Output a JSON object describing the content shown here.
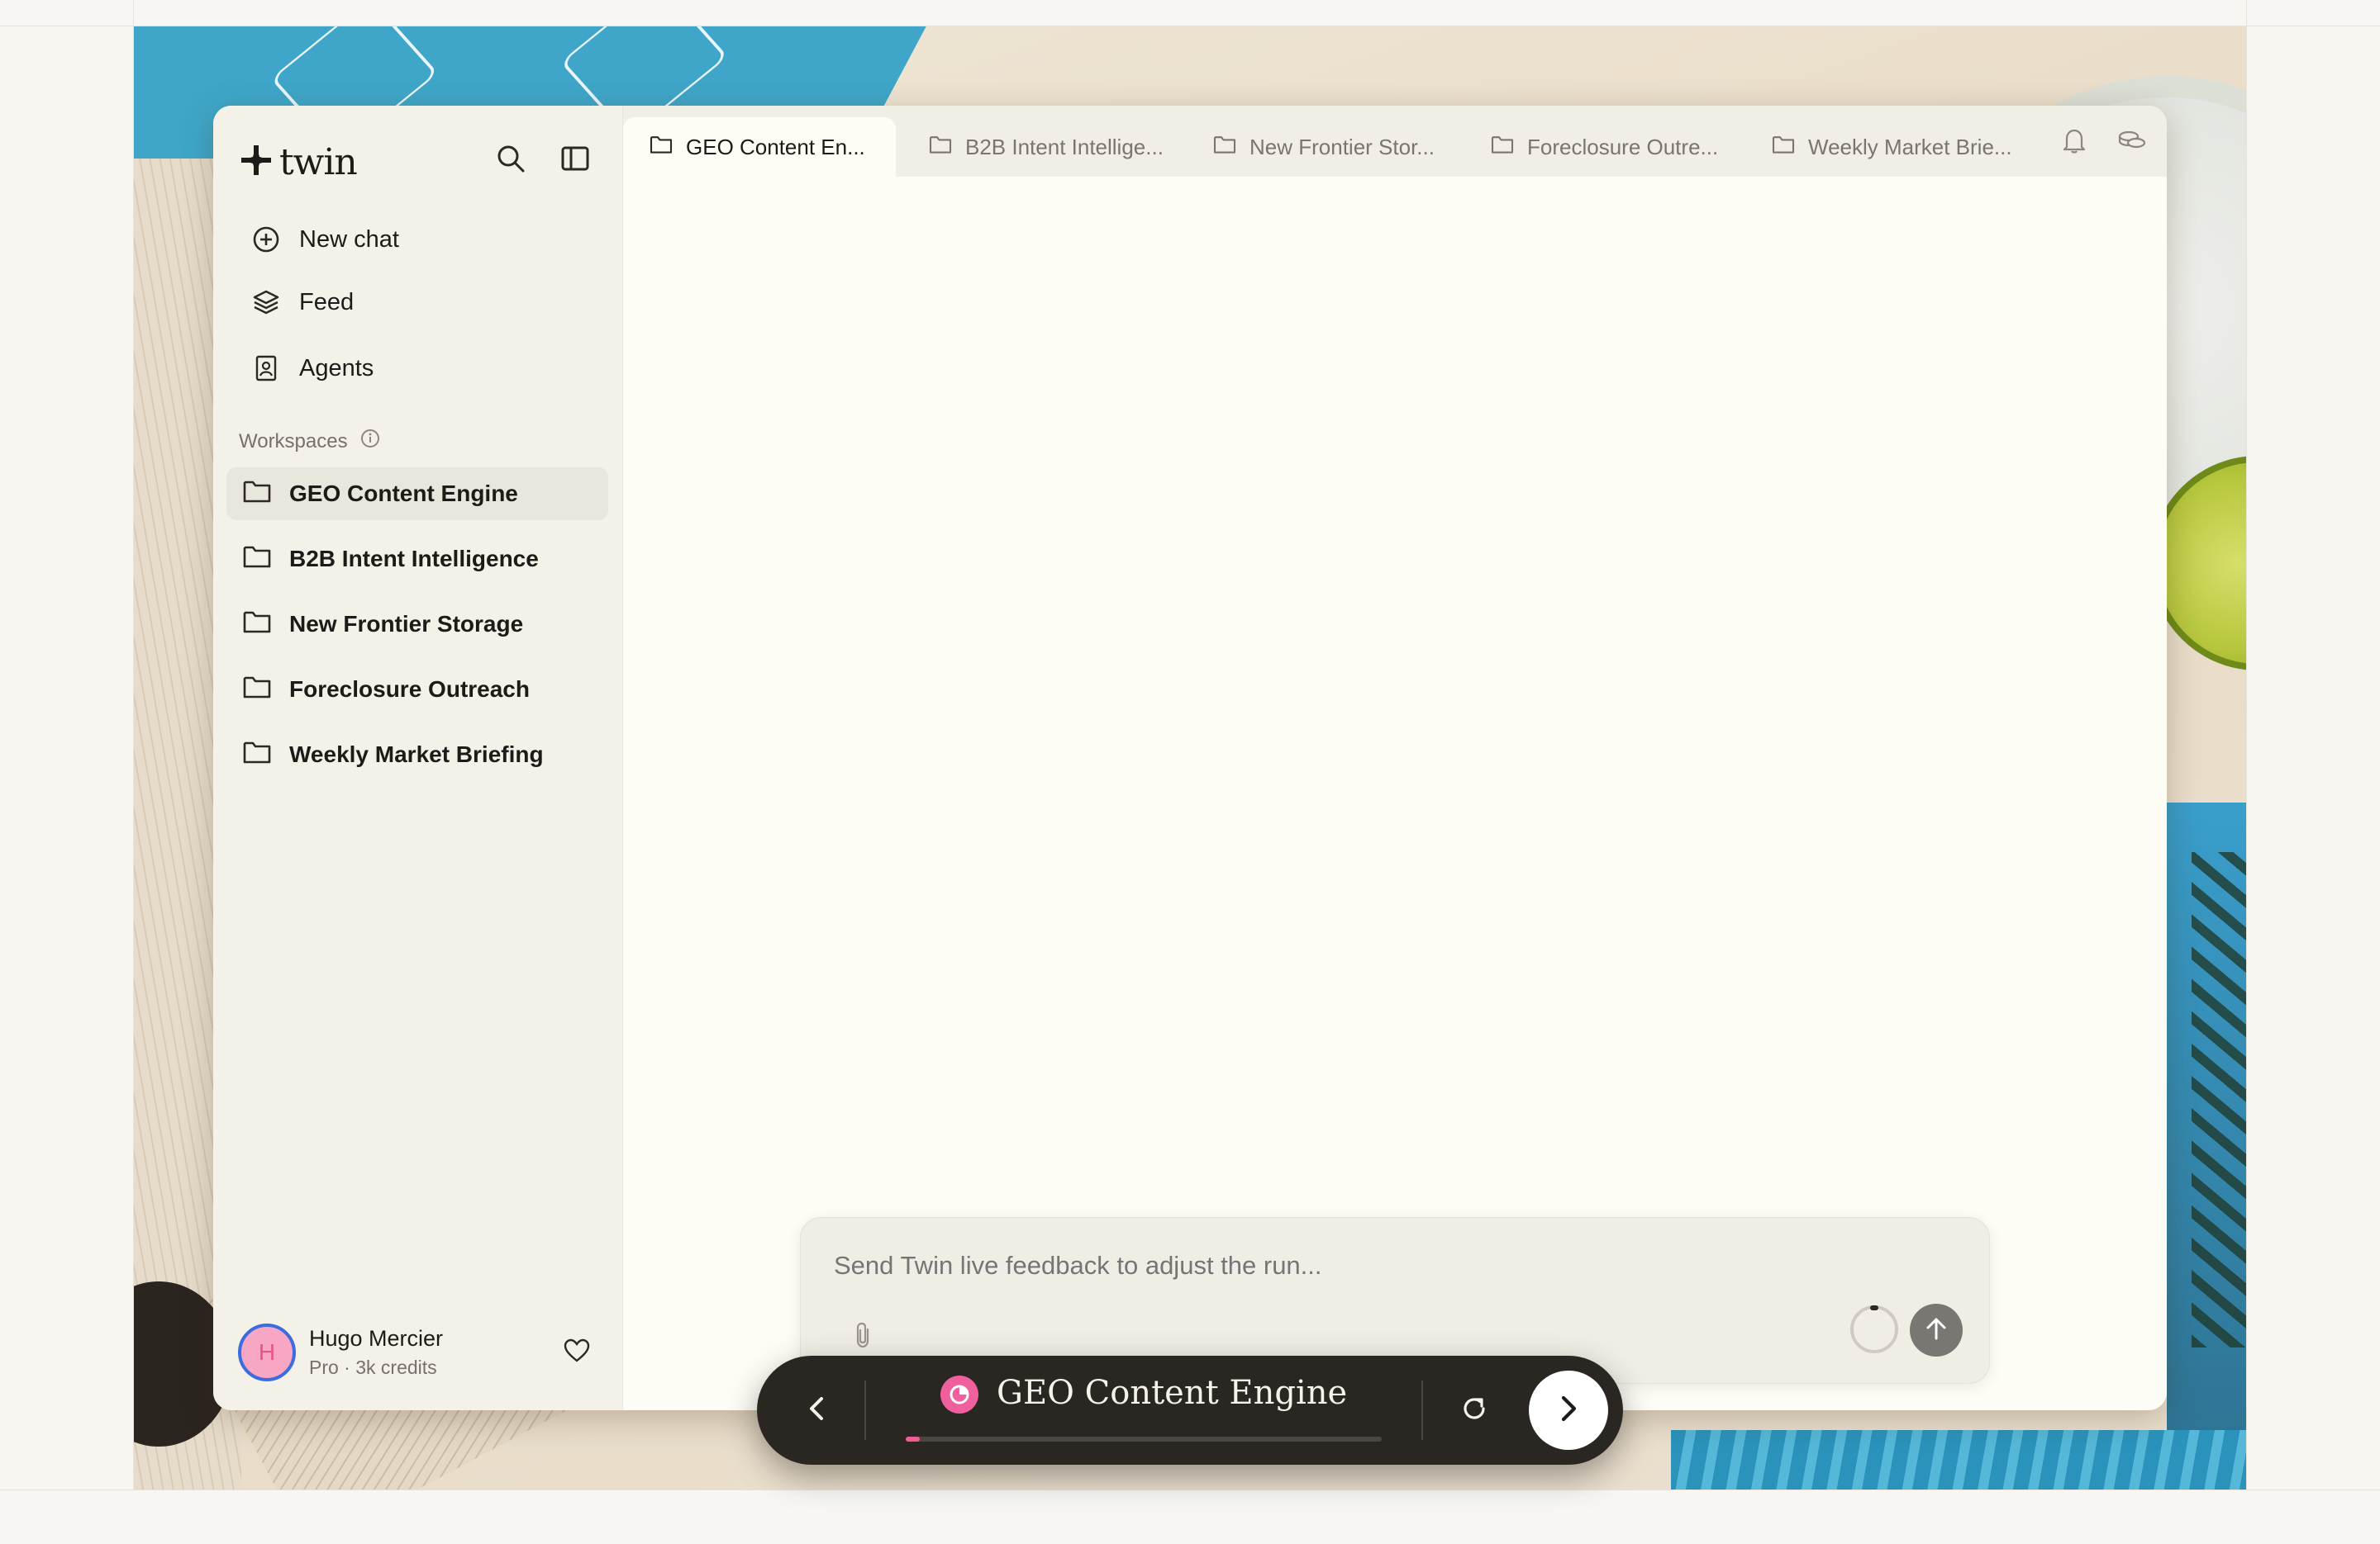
{
  "app": {
    "brand_name": "twin"
  },
  "sidebar": {
    "nav": [
      {
        "label": "New chat",
        "icon": "plus-circle-icon"
      },
      {
        "label": "Feed",
        "icon": "layers-icon"
      },
      {
        "label": "Agents",
        "icon": "badge-icon"
      }
    ],
    "workspaces_header": "Workspaces",
    "workspaces": [
      {
        "label": "GEO Content Engine",
        "active": true
      },
      {
        "label": "B2B Intent Intelligence",
        "active": false
      },
      {
        "label": "New Frontier Storage",
        "active": false
      },
      {
        "label": "Foreclosure Outreach",
        "active": false
      },
      {
        "label": "Weekly Market Briefing",
        "active": false
      }
    ],
    "user": {
      "initial": "H",
      "name": "Hugo Mercier",
      "plan": "Pro · 3k credits"
    }
  },
  "tabs": [
    {
      "label": "GEO Content En...",
      "active": true
    },
    {
      "label": "B2B Intent Intellige...",
      "active": false
    },
    {
      "label": "New Frontier Stor...",
      "active": false
    },
    {
      "label": "Foreclosure Outre...",
      "active": false
    },
    {
      "label": "Weekly Market Brie...",
      "active": false
    }
  ],
  "composer": {
    "placeholder": "Send Twin live feedback to adjust the run..."
  },
  "runbar": {
    "title": "GEO Content Engine",
    "progress": 0.03
  },
  "colors": {
    "accent_pink": "#ef5d97",
    "avatar_ring": "#3b6ce0",
    "runbar_bg": "#2a2722",
    "sidebar_bg": "#f3f1e8",
    "content_bg": "#fdfcf5"
  }
}
